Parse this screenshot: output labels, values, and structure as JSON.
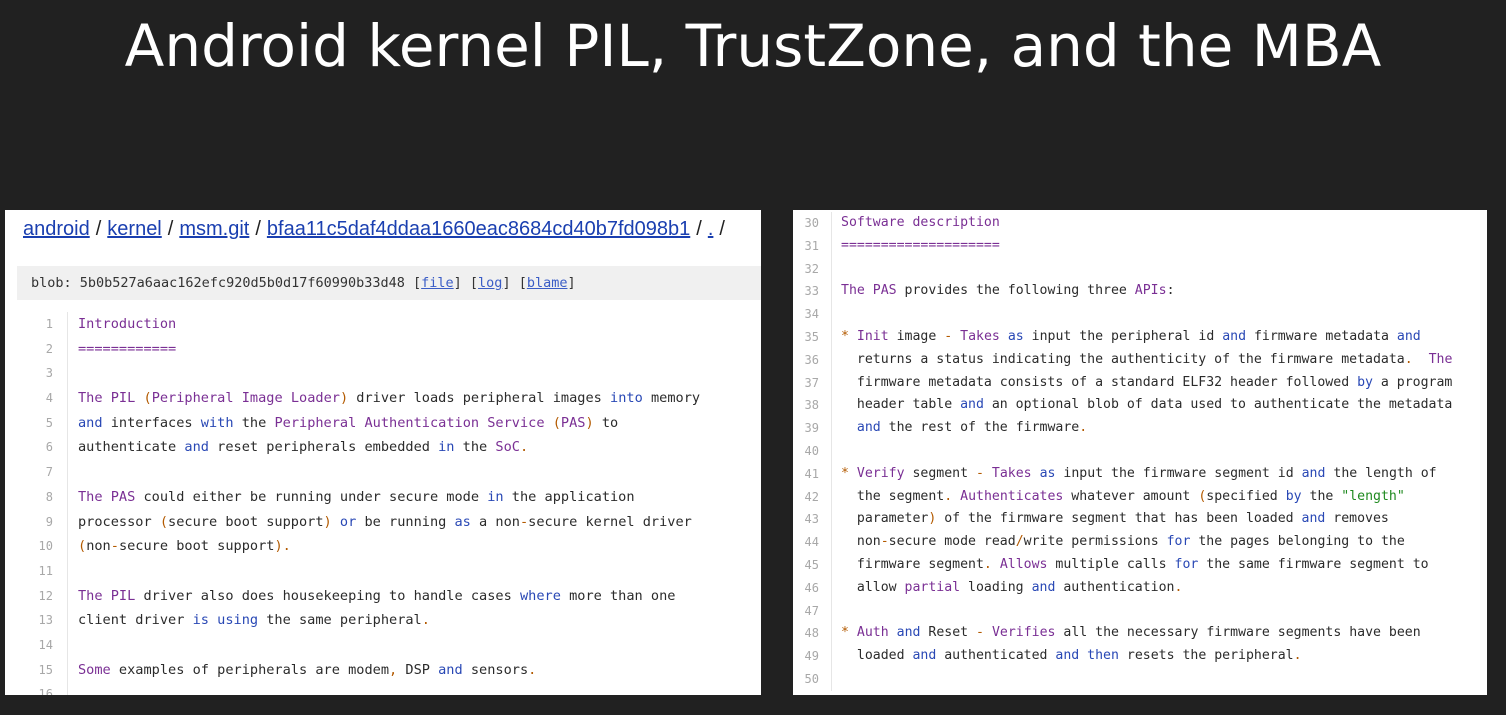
{
  "slide": {
    "title": "Android kernel PIL, TrustZone, and the MBA"
  },
  "left_panel": {
    "breadcrumb": {
      "items": [
        "android",
        "kernel",
        "msm.git",
        "bfaa11c5daf4ddaa1660eac8684cd40b7fd098b1",
        ".",
        "/"
      ],
      "separator": "/"
    },
    "blob_bar": {
      "prefix": "blob: 5b0b527a6aac162efc920d5b0d17f60990b33d48",
      "file_link": "file",
      "log_link": "log",
      "blame_link": "blame"
    },
    "lines": [
      {
        "n": "1",
        "text": "Introduction"
      },
      {
        "n": "2",
        "text": "============"
      },
      {
        "n": "3",
        "text": ""
      },
      {
        "n": "4",
        "text": "The PIL (Peripheral Image Loader) driver loads peripheral images into memory"
      },
      {
        "n": "5",
        "text": "and interfaces with the Peripheral Authentication Service (PAS) to"
      },
      {
        "n": "6",
        "text": "authenticate and reset peripherals embedded in the SoC."
      },
      {
        "n": "7",
        "text": ""
      },
      {
        "n": "8",
        "text": "The PAS could either be running under secure mode in the application"
      },
      {
        "n": "9",
        "text": "processor (secure boot support) or be running as a non-secure kernel driver"
      },
      {
        "n": "10",
        "text": "(non-secure boot support)."
      },
      {
        "n": "11",
        "text": ""
      },
      {
        "n": "12",
        "text": "The PIL driver also does housekeeping to handle cases where more than one"
      },
      {
        "n": "13",
        "text": "client driver is using the same peripheral."
      },
      {
        "n": "14",
        "text": ""
      },
      {
        "n": "15",
        "text": "Some examples of peripherals are modem, DSP and sensors."
      },
      {
        "n": "16",
        "text": ""
      }
    ]
  },
  "right_panel": {
    "lines": [
      {
        "n": "30",
        "text": "Software description"
      },
      {
        "n": "31",
        "text": "===================="
      },
      {
        "n": "32",
        "text": ""
      },
      {
        "n": "33",
        "text": "The PAS provides the following three APIs:"
      },
      {
        "n": "34",
        "text": ""
      },
      {
        "n": "35",
        "text": "* Init image - Takes as input the peripheral id and firmware metadata and"
      },
      {
        "n": "36",
        "text": "  returns a status indicating the authenticity of the firmware metadata.  The"
      },
      {
        "n": "37",
        "text": "  firmware metadata consists of a standard ELF32 header followed by a program"
      },
      {
        "n": "38",
        "text": "  header table and an optional blob of data used to authenticate the metadata"
      },
      {
        "n": "39",
        "text": "  and the rest of the firmware."
      },
      {
        "n": "40",
        "text": ""
      },
      {
        "n": "41",
        "text": "* Verify segment - Takes as input the firmware segment id and the length of"
      },
      {
        "n": "42",
        "text": "  the segment. Authenticates whatever amount (specified by the \"length\""
      },
      {
        "n": "43",
        "text": "  parameter) of the firmware segment that has been loaded and removes"
      },
      {
        "n": "44",
        "text": "  non-secure mode read/write permissions for the pages belonging to the"
      },
      {
        "n": "45",
        "text": "  firmware segment. Allows multiple calls for the same firmware segment to"
      },
      {
        "n": "46",
        "text": "  allow partial loading and authentication."
      },
      {
        "n": "47",
        "text": ""
      },
      {
        "n": "48",
        "text": "* Auth and Reset - Verifies all the necessary firmware segments have been"
      },
      {
        "n": "49",
        "text": "  loaded and authenticated and then resets the peripheral."
      },
      {
        "n": "50",
        "text": ""
      }
    ]
  },
  "colors": {
    "slide_background": "#212121",
    "title_text": "#ffffff",
    "panel_background": "#ffffff",
    "link": "#1a3fb0",
    "keyword": "#2948b5",
    "heading": "#7a2f94",
    "line_number": "#a8a8a8"
  },
  "icons": []
}
